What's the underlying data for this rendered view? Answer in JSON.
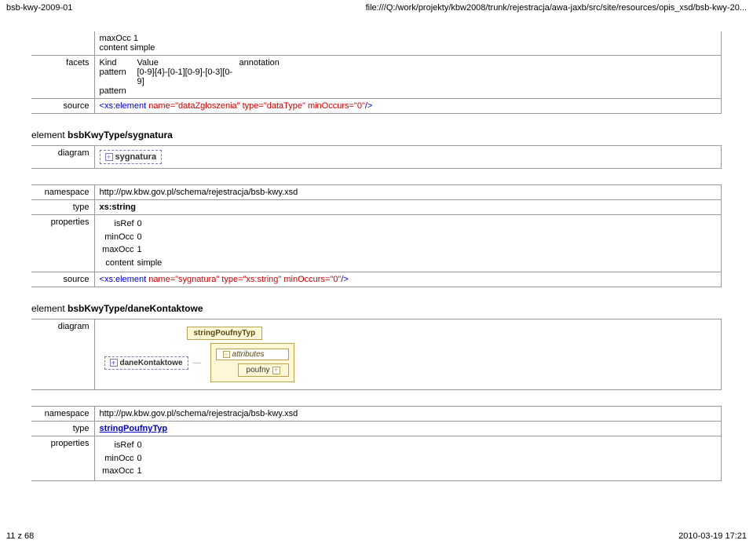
{
  "header": {
    "left": "bsb-kwy-2009-01",
    "right": "file:///Q:/work/projekty/kbw2008/trunk/rejestracja/awa-jaxb/src/site/resources/opis_xsd/bsb-kwy-20..."
  },
  "footer": {
    "left": "11 z 68",
    "right": "2010-03-19 17:21"
  },
  "block1": {
    "props_maxocc": "maxOcc 1",
    "props_content": "content simple",
    "facets_label": "facets",
    "kind_header": "Kind",
    "value_header": "Value",
    "annotation_header": "annotation",
    "row1_kind": "pattern",
    "row1_value": "[0-9]{4}-[0-1][0-9]-[0-3][0-9]",
    "row2_kind": "pattern",
    "source_label": "source",
    "source_prefix": "<",
    "source_tag": "xs:element",
    "source_attrs": " name=\"dataZgloszenia\" type=\"dataType\" minOccurs=\"0\"",
    "source_suffix": "/>"
  },
  "section_sygnatura": {
    "word": "element ",
    "name": "bsbKwyType/sygnatura",
    "diagram_label": "diagram",
    "diagram_text": "sygnatura",
    "namespace_label": "namespace",
    "namespace_value": "http://pw.kbw.gov.pl/schema/rejestracja/bsb-kwy.xsd",
    "type_label": "type",
    "type_value": "xs:string",
    "properties_label": "properties",
    "isref": "0",
    "minocc": "0",
    "maxocc": "1",
    "content": "simple",
    "source_label": "source",
    "source_tag": "xs:element",
    "source_attrs": " name=\"sygnatura\" type=\"xs:string\" minOccurs=\"0\"",
    "source_suffix": "/>"
  },
  "section_dane": {
    "word": "element ",
    "name": "bsbKwyType/daneKontaktowe",
    "diagram_label": "diagram",
    "cd_type": "stringPoufnyTyp",
    "cd_elem": "daneKontaktowe",
    "cd_attributes": "attributes",
    "cd_poufny": "poufny",
    "namespace_label": "namespace",
    "namespace_value": "http://pw.kbw.gov.pl/schema/rejestracja/bsb-kwy.xsd",
    "type_label": "type",
    "type_value": "stringPoufnyTyp",
    "properties_label": "properties",
    "isref": "0",
    "minocc": "0",
    "maxocc": "1"
  },
  "labels": {
    "isref": "isRef",
    "minocc": "minOcc",
    "maxocc": "maxOcc",
    "content": "content"
  }
}
